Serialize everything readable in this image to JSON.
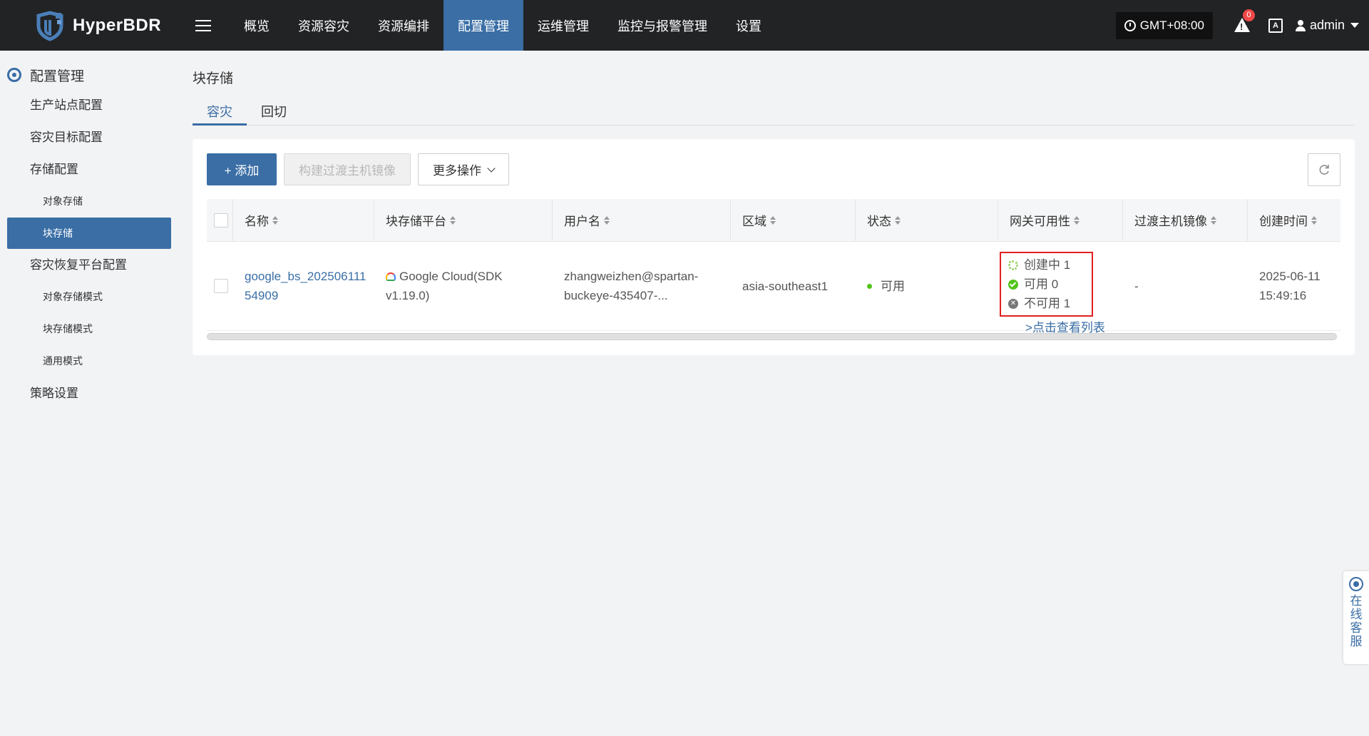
{
  "brand": {
    "name": "HyperBDR"
  },
  "nav": [
    "概览",
    "资源容灾",
    "资源编排",
    "配置管理",
    "运维管理",
    "监控与报警管理",
    "设置"
  ],
  "top_right": {
    "timezone": "GMT+08:00",
    "alert_count": "0",
    "lang_label": "A",
    "user": "admin"
  },
  "sidebar": {
    "header": "配置管理",
    "items": [
      {
        "label": "生产站点配置",
        "level": 1
      },
      {
        "label": "容灾目标配置",
        "level": 1
      },
      {
        "label": "存储配置",
        "level": 1
      },
      {
        "label": "对象存储",
        "level": 2
      },
      {
        "label": "块存储",
        "level": 2,
        "active": true
      },
      {
        "label": "容灾恢复平台配置",
        "level": 1
      },
      {
        "label": "对象存储模式",
        "level": 2
      },
      {
        "label": "块存储模式",
        "level": 2
      },
      {
        "label": "通用模式",
        "level": 2
      },
      {
        "label": "策略设置",
        "level": 1
      }
    ]
  },
  "main": {
    "title": "块存储",
    "tabs": [
      "容灾",
      "回切"
    ],
    "toolbar": {
      "add": "+ 添加",
      "build": "构建过渡主机镜像",
      "more": "更多操作"
    },
    "table": {
      "headers": [
        "名称",
        "块存储平台",
        "用户名",
        "区域",
        "状态",
        "网关可用性",
        "过渡主机镜像",
        "创建时间"
      ],
      "row": {
        "name_line1": "google_bs_202506111",
        "name_line2": "54909",
        "platform_line1": "Google Cloud(SDK",
        "platform_line2": "v1.19.0)",
        "user_line1": "zhangweizhen@spartan-",
        "user_line2": "buckeye-435407-...",
        "region": "asia-southeast1",
        "status": "可用",
        "gw_creating": "创建中 1",
        "gw_available": "可用 0",
        "gw_unavailable": "不可用 1",
        "gw_link": ">点击查看列表",
        "image": "-",
        "created_line1": "2025-06-11",
        "created_line2": "15:49:16"
      }
    }
  },
  "support": {
    "label": "在线客服"
  },
  "colors": {
    "accent": "#3a6ea5",
    "topbar": "#222325",
    "status_ok": "#52c41a",
    "highlight": "#e02020"
  }
}
